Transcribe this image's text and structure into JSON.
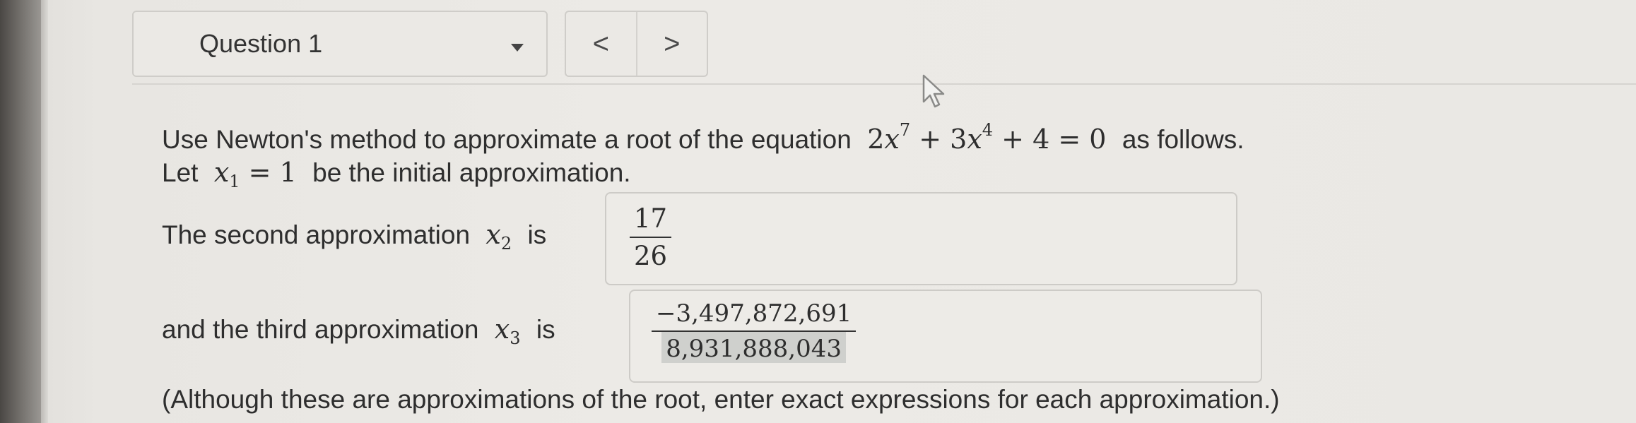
{
  "header": {
    "question_select_label": "Question 1",
    "prev_label": "<",
    "next_label": ">"
  },
  "problem": {
    "line1_intro": "Use Newton's method to approximate a root of the equation",
    "line1_end": "as follows.",
    "line2_start": "Let",
    "line2_end": "be the initial approximation.",
    "second_prefix": "The second approximation",
    "second_is": "is",
    "third_prefix": "and the third approximation",
    "third_is": "is",
    "note": "(Although these are approximations of the root, enter exact expressions for each approximation.)"
  },
  "equation": {
    "coef1": "2",
    "var": "x",
    "exp1": "7",
    "plus1": "+",
    "coef2": "3",
    "exp2": "4",
    "plus2": "+",
    "const": "4",
    "eq": "=",
    "rhs": "0"
  },
  "initial": {
    "var": "x",
    "sub": "1",
    "eq": "=",
    "value": "1"
  },
  "answers": {
    "x2_var": "x",
    "x2_sub": "2",
    "x2_numerator": "17",
    "x2_denominator": "26",
    "x3_var": "x",
    "x3_sub": "3",
    "x3_numerator": "−3,497,872,691",
    "x3_denominator": "8,931,888,043"
  }
}
